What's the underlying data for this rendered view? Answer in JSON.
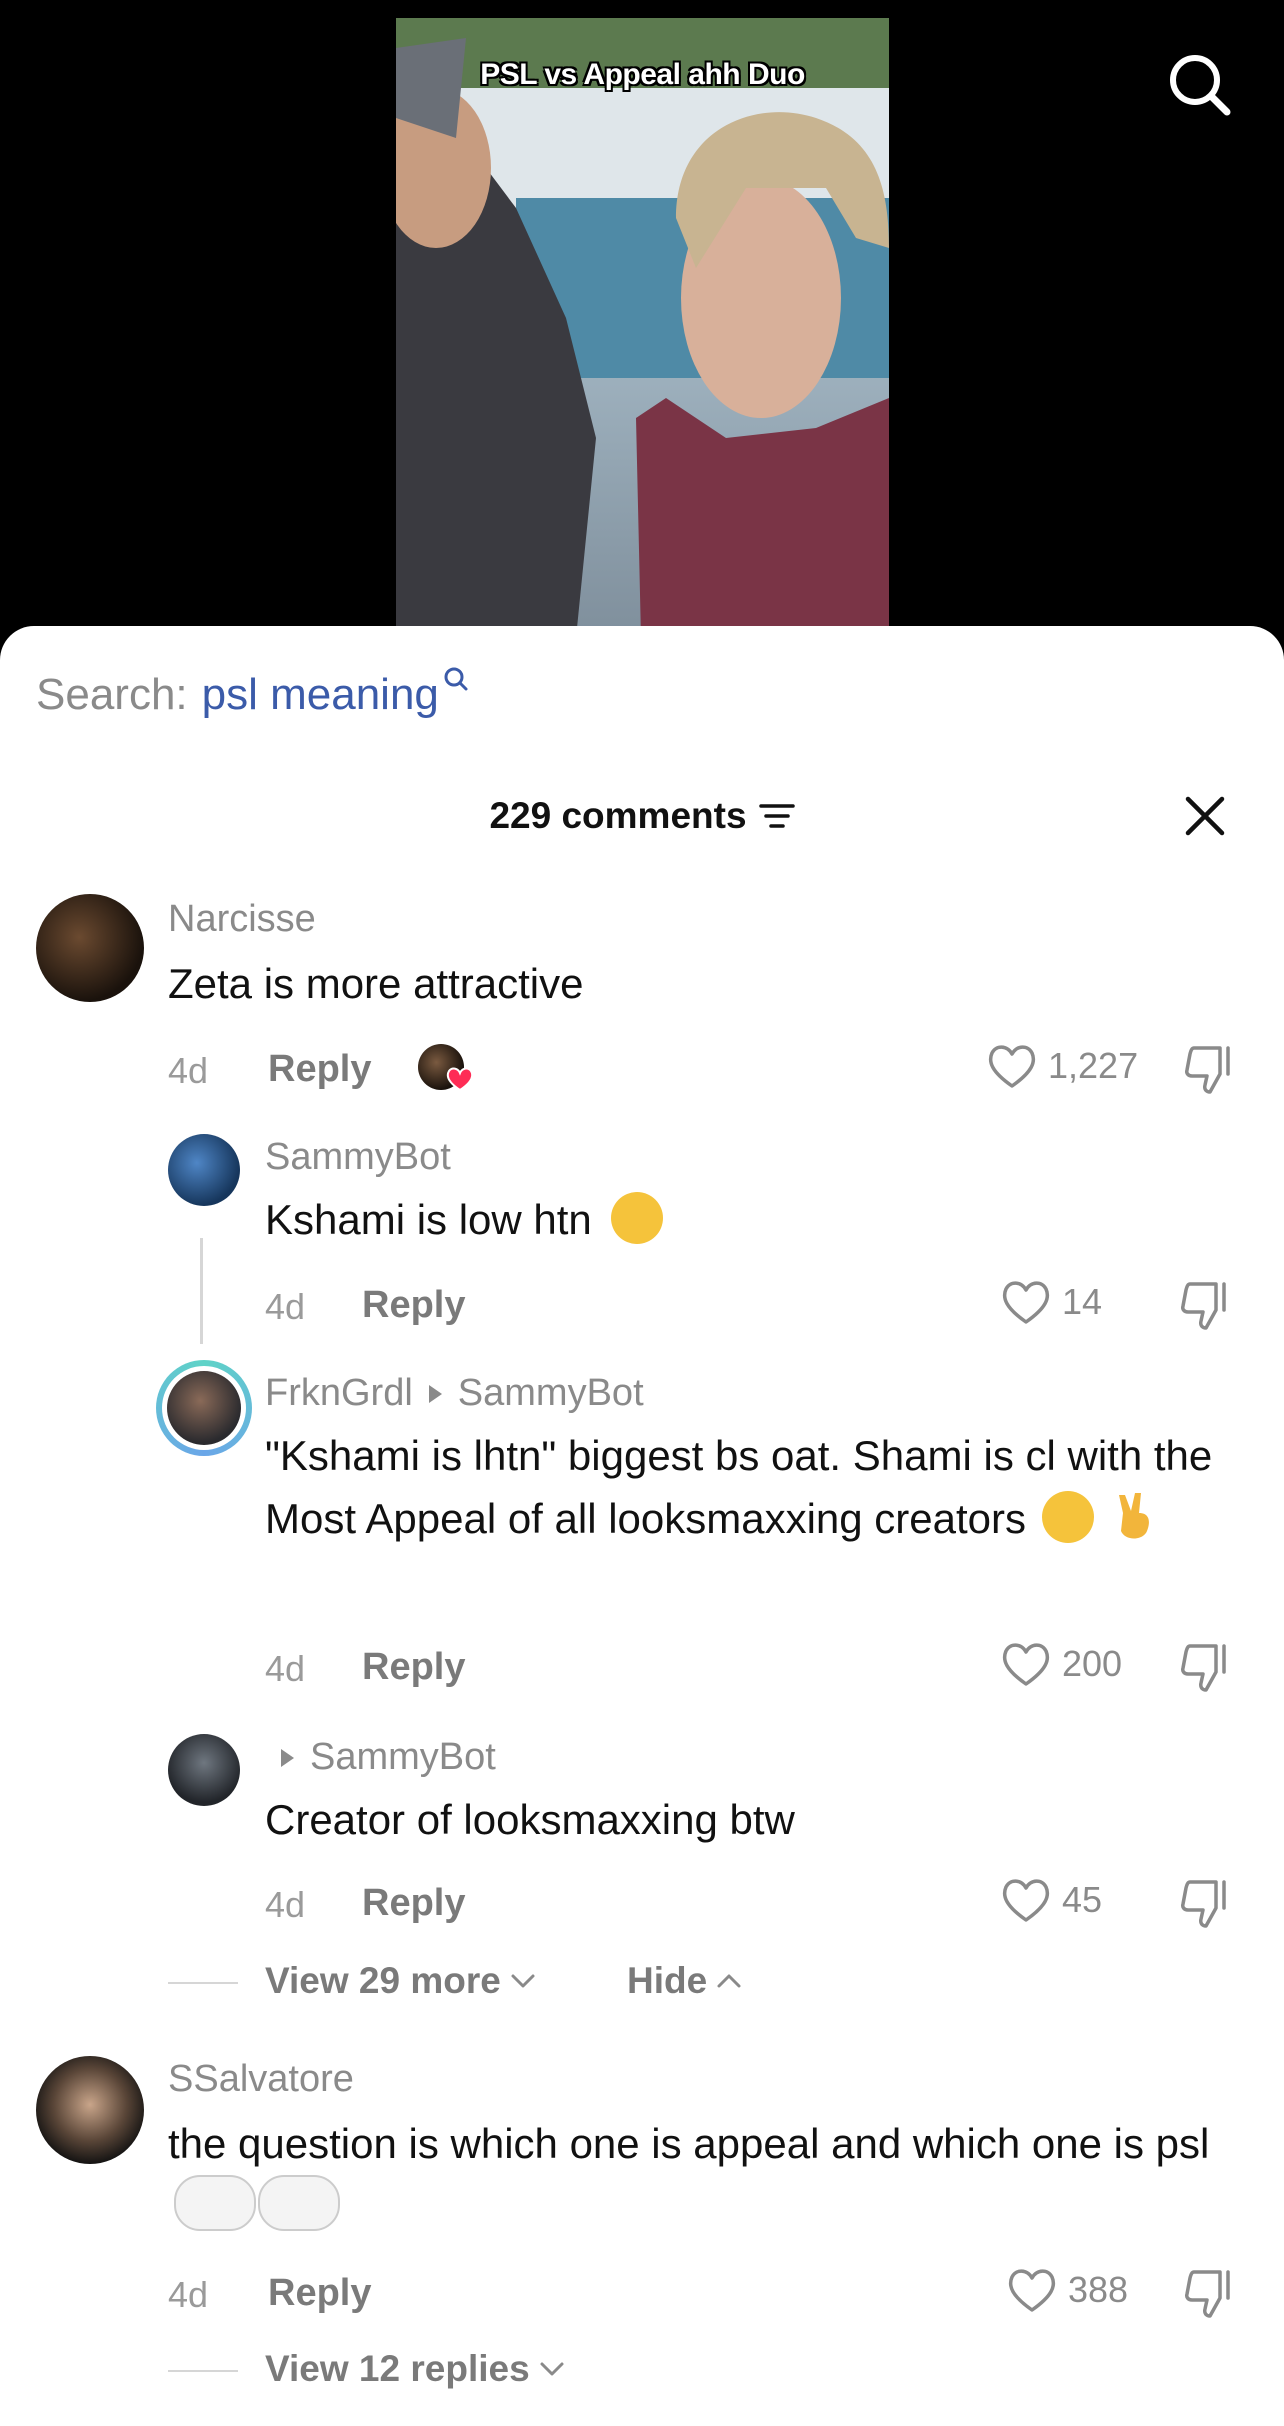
{
  "video": {
    "caption": "PSL vs Appeal ahh Duo"
  },
  "search_suggestion": {
    "prefix": "Search:",
    "term": "psl meaning"
  },
  "header": {
    "count_label": "229 comments"
  },
  "comments": [
    {
      "user": "Narcisse",
      "text": "Zeta is more attractive",
      "age": "4d",
      "reply_label": "Reply",
      "likes": "1,227",
      "creator_liked": true
    },
    {
      "user": "SammyBot",
      "text": "Kshami is low htn",
      "age": "4d",
      "reply_label": "Reply",
      "likes": "14"
    },
    {
      "user": "FrknGrdl",
      "reply_to": "SammyBot",
      "text": "\"Kshami is lhtn\" biggest bs oat. Shami is cl with the Most Appeal of all looksmaxxing creators",
      "age": "4d",
      "reply_label": "Reply",
      "likes": "200"
    },
    {
      "user": "",
      "reply_to": "SammyBot",
      "text": "Creator of looksmaxxing btw",
      "age": "4d",
      "reply_label": "Reply",
      "likes": "45"
    },
    {
      "user": "SSalvatore",
      "text": "the question is which one is appeal and which one is psl",
      "age": "4d",
      "reply_label": "Reply",
      "likes": "388"
    }
  ],
  "thread_controls": {
    "view_more": "View 29 more",
    "hide": "Hide"
  },
  "view_replies": "View 12 replies"
}
